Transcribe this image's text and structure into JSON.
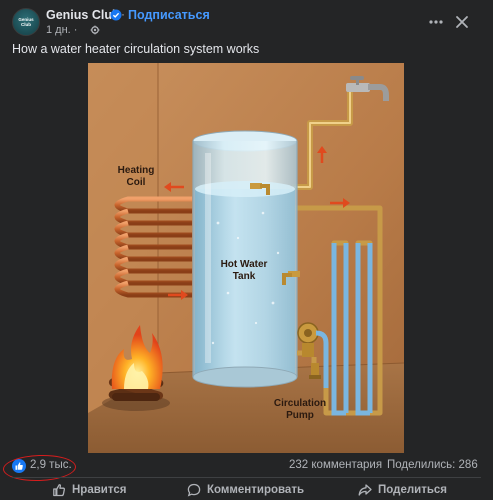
{
  "header": {
    "page_name": "Genius Club",
    "subscribe_label": "Подписаться",
    "time": "1 дн. ·",
    "avatar_text_line1": "Genius",
    "avatar_text_line2": "Club"
  },
  "post": {
    "text": "How a water heater circulation system works"
  },
  "illustration": {
    "label_heating": "Heating",
    "label_coil": "Coil",
    "label_tank_1": "Hot Water",
    "label_tank_2": "Tank",
    "label_pump_1": "Circulation",
    "label_pump_2": "Pump"
  },
  "stats": {
    "likes": "2,9 тыс.",
    "comments": "232 комментария",
    "shares": "Поделились: 286"
  },
  "actions": {
    "like": "Нравится",
    "comment": "Комментировать",
    "share": "Поделиться"
  },
  "colors": {
    "accent": "#4599ff",
    "like_blue": "#1877f2",
    "highlight": "#d61d1d"
  }
}
